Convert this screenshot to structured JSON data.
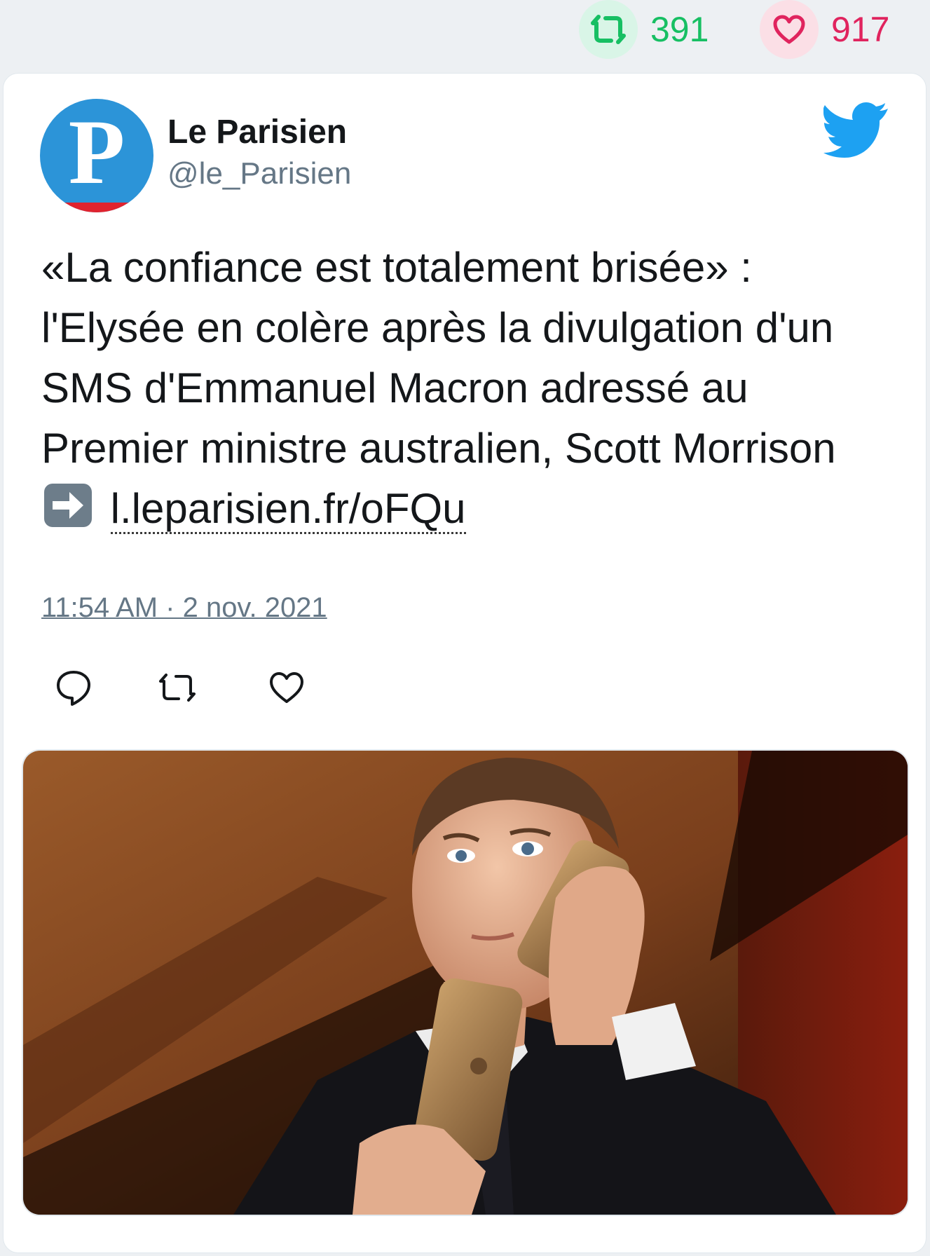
{
  "stats": {
    "retweet_count": "391",
    "like_count": "917",
    "retweet_icon": "retweet-icon",
    "like_icon": "heart-icon"
  },
  "author": {
    "name": "Le Parisien",
    "handle": "@le_Parisien",
    "avatar_letter": "P"
  },
  "tweet": {
    "text": "«La confiance est totalement brisée» : l'Elysée en colère après la divulgation d'un SMS d'Emmanuel Macron adressé au Premier ministre australien, Scott Morrison",
    "emoji": "right-arrow-emoji",
    "link_text": "l.leparisien.fr/oFQu",
    "timestamp": "11:54 AM · 2 nov. 2021"
  },
  "actions": [
    "reply-icon",
    "retweet-icon",
    "like-icon"
  ],
  "brand": {
    "logo": "twitter-bird-icon"
  },
  "colors": {
    "retweet_green": "#17bf63",
    "like_red": "#e0245e",
    "twitter_blue": "#1da1f2",
    "muted_text": "#657786",
    "avatar_blue": "#2c94d8",
    "avatar_red": "#e0232e"
  }
}
